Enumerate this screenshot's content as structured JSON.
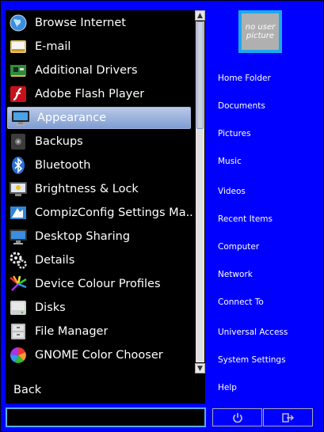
{
  "apps": [
    {
      "label": "Browse Internet",
      "icon": "globe-icon"
    },
    {
      "label": "E-mail",
      "icon": "envelope-icon"
    },
    {
      "label": "Additional Drivers",
      "icon": "circuit-board-icon"
    },
    {
      "label": "Adobe Flash Player",
      "icon": "flash-icon"
    },
    {
      "label": "Appearance",
      "icon": "monitor-icon",
      "selected": true
    },
    {
      "label": "Backups",
      "icon": "safe-icon"
    },
    {
      "label": "Bluetooth",
      "icon": "bluetooth-icon"
    },
    {
      "label": "Brightness & Lock",
      "icon": "brightness-monitor-icon"
    },
    {
      "label": "CompizConfig Settings Ma...",
      "icon": "compiz-icon"
    },
    {
      "label": "Desktop Sharing",
      "icon": "desktop-icon"
    },
    {
      "label": "Details",
      "icon": "gears-icon"
    },
    {
      "label": "Device Colour Profiles",
      "icon": "color-profiles-icon"
    },
    {
      "label": "Disks",
      "icon": "disk-icon"
    },
    {
      "label": "File Manager",
      "icon": "file-cabinet-icon"
    },
    {
      "label": "GNOME Color Chooser",
      "icon": "color-wheel-icon"
    }
  ],
  "back_label": "Back",
  "search": {
    "value": "",
    "placeholder": ""
  },
  "avatar_text": "no user picture",
  "places": [
    "Home Folder",
    "Documents",
    "Pictures",
    "Music",
    "Videos",
    "Recent Items",
    "Computer",
    "Network",
    "Connect To",
    "Universal Access",
    "System Settings",
    "Help"
  ],
  "colors": {
    "background": "#0000ff",
    "panel": "#000000",
    "selection": "#a9bde3",
    "avatar_frame": "#1ba9ee"
  },
  "scrollbar": {
    "up_arrow": "▲",
    "down_arrow": "▼"
  },
  "footer": {
    "power_icon": "power-icon",
    "logout_icon": "logout-icon"
  }
}
